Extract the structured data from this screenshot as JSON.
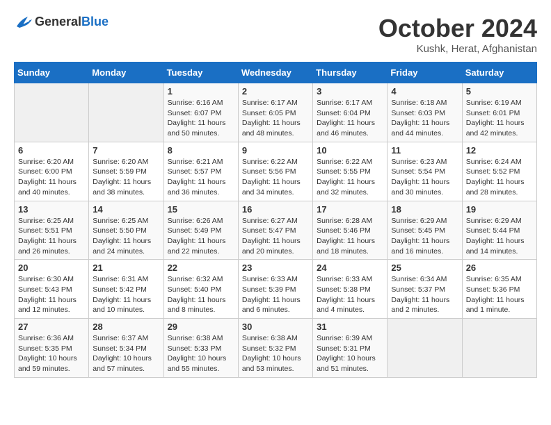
{
  "logo": {
    "general": "General",
    "blue": "Blue"
  },
  "title": "October 2024",
  "location": "Kushk, Herat, Afghanistan",
  "days_of_week": [
    "Sunday",
    "Monday",
    "Tuesday",
    "Wednesday",
    "Thursday",
    "Friday",
    "Saturday"
  ],
  "weeks": [
    [
      {
        "day": "",
        "empty": true
      },
      {
        "day": "",
        "empty": true
      },
      {
        "day": "1",
        "sunrise": "Sunrise: 6:16 AM",
        "sunset": "Sunset: 6:07 PM",
        "daylight": "Daylight: 11 hours and 50 minutes."
      },
      {
        "day": "2",
        "sunrise": "Sunrise: 6:17 AM",
        "sunset": "Sunset: 6:05 PM",
        "daylight": "Daylight: 11 hours and 48 minutes."
      },
      {
        "day": "3",
        "sunrise": "Sunrise: 6:17 AM",
        "sunset": "Sunset: 6:04 PM",
        "daylight": "Daylight: 11 hours and 46 minutes."
      },
      {
        "day": "4",
        "sunrise": "Sunrise: 6:18 AM",
        "sunset": "Sunset: 6:03 PM",
        "daylight": "Daylight: 11 hours and 44 minutes."
      },
      {
        "day": "5",
        "sunrise": "Sunrise: 6:19 AM",
        "sunset": "Sunset: 6:01 PM",
        "daylight": "Daylight: 11 hours and 42 minutes."
      }
    ],
    [
      {
        "day": "6",
        "sunrise": "Sunrise: 6:20 AM",
        "sunset": "Sunset: 6:00 PM",
        "daylight": "Daylight: 11 hours and 40 minutes."
      },
      {
        "day": "7",
        "sunrise": "Sunrise: 6:20 AM",
        "sunset": "Sunset: 5:59 PM",
        "daylight": "Daylight: 11 hours and 38 minutes."
      },
      {
        "day": "8",
        "sunrise": "Sunrise: 6:21 AM",
        "sunset": "Sunset: 5:57 PM",
        "daylight": "Daylight: 11 hours and 36 minutes."
      },
      {
        "day": "9",
        "sunrise": "Sunrise: 6:22 AM",
        "sunset": "Sunset: 5:56 PM",
        "daylight": "Daylight: 11 hours and 34 minutes."
      },
      {
        "day": "10",
        "sunrise": "Sunrise: 6:22 AM",
        "sunset": "Sunset: 5:55 PM",
        "daylight": "Daylight: 11 hours and 32 minutes."
      },
      {
        "day": "11",
        "sunrise": "Sunrise: 6:23 AM",
        "sunset": "Sunset: 5:54 PM",
        "daylight": "Daylight: 11 hours and 30 minutes."
      },
      {
        "day": "12",
        "sunrise": "Sunrise: 6:24 AM",
        "sunset": "Sunset: 5:52 PM",
        "daylight": "Daylight: 11 hours and 28 minutes."
      }
    ],
    [
      {
        "day": "13",
        "sunrise": "Sunrise: 6:25 AM",
        "sunset": "Sunset: 5:51 PM",
        "daylight": "Daylight: 11 hours and 26 minutes."
      },
      {
        "day": "14",
        "sunrise": "Sunrise: 6:25 AM",
        "sunset": "Sunset: 5:50 PM",
        "daylight": "Daylight: 11 hours and 24 minutes."
      },
      {
        "day": "15",
        "sunrise": "Sunrise: 6:26 AM",
        "sunset": "Sunset: 5:49 PM",
        "daylight": "Daylight: 11 hours and 22 minutes."
      },
      {
        "day": "16",
        "sunrise": "Sunrise: 6:27 AM",
        "sunset": "Sunset: 5:47 PM",
        "daylight": "Daylight: 11 hours and 20 minutes."
      },
      {
        "day": "17",
        "sunrise": "Sunrise: 6:28 AM",
        "sunset": "Sunset: 5:46 PM",
        "daylight": "Daylight: 11 hours and 18 minutes."
      },
      {
        "day": "18",
        "sunrise": "Sunrise: 6:29 AM",
        "sunset": "Sunset: 5:45 PM",
        "daylight": "Daylight: 11 hours and 16 minutes."
      },
      {
        "day": "19",
        "sunrise": "Sunrise: 6:29 AM",
        "sunset": "Sunset: 5:44 PM",
        "daylight": "Daylight: 11 hours and 14 minutes."
      }
    ],
    [
      {
        "day": "20",
        "sunrise": "Sunrise: 6:30 AM",
        "sunset": "Sunset: 5:43 PM",
        "daylight": "Daylight: 11 hours and 12 minutes."
      },
      {
        "day": "21",
        "sunrise": "Sunrise: 6:31 AM",
        "sunset": "Sunset: 5:42 PM",
        "daylight": "Daylight: 11 hours and 10 minutes."
      },
      {
        "day": "22",
        "sunrise": "Sunrise: 6:32 AM",
        "sunset": "Sunset: 5:40 PM",
        "daylight": "Daylight: 11 hours and 8 minutes."
      },
      {
        "day": "23",
        "sunrise": "Sunrise: 6:33 AM",
        "sunset": "Sunset: 5:39 PM",
        "daylight": "Daylight: 11 hours and 6 minutes."
      },
      {
        "day": "24",
        "sunrise": "Sunrise: 6:33 AM",
        "sunset": "Sunset: 5:38 PM",
        "daylight": "Daylight: 11 hours and 4 minutes."
      },
      {
        "day": "25",
        "sunrise": "Sunrise: 6:34 AM",
        "sunset": "Sunset: 5:37 PM",
        "daylight": "Daylight: 11 hours and 2 minutes."
      },
      {
        "day": "26",
        "sunrise": "Sunrise: 6:35 AM",
        "sunset": "Sunset: 5:36 PM",
        "daylight": "Daylight: 11 hours and 1 minute."
      }
    ],
    [
      {
        "day": "27",
        "sunrise": "Sunrise: 6:36 AM",
        "sunset": "Sunset: 5:35 PM",
        "daylight": "Daylight: 10 hours and 59 minutes."
      },
      {
        "day": "28",
        "sunrise": "Sunrise: 6:37 AM",
        "sunset": "Sunset: 5:34 PM",
        "daylight": "Daylight: 10 hours and 57 minutes."
      },
      {
        "day": "29",
        "sunrise": "Sunrise: 6:38 AM",
        "sunset": "Sunset: 5:33 PM",
        "daylight": "Daylight: 10 hours and 55 minutes."
      },
      {
        "day": "30",
        "sunrise": "Sunrise: 6:38 AM",
        "sunset": "Sunset: 5:32 PM",
        "daylight": "Daylight: 10 hours and 53 minutes."
      },
      {
        "day": "31",
        "sunrise": "Sunrise: 6:39 AM",
        "sunset": "Sunset: 5:31 PM",
        "daylight": "Daylight: 10 hours and 51 minutes."
      },
      {
        "day": "",
        "empty": true
      },
      {
        "day": "",
        "empty": true
      }
    ]
  ]
}
